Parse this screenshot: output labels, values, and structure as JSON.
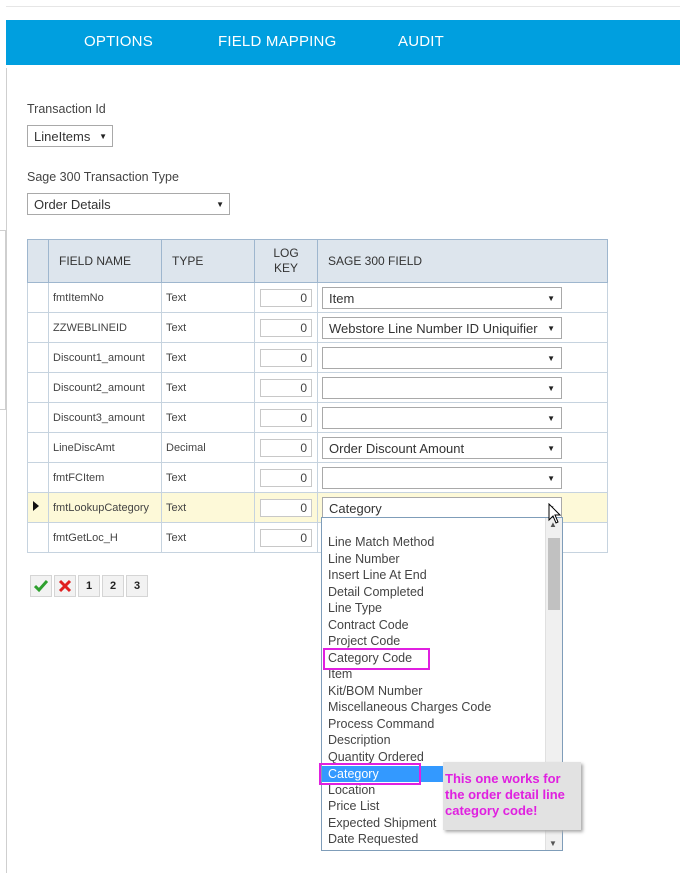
{
  "nav": {
    "tabs": [
      "OPTIONS",
      "FIELD MAPPING",
      "AUDIT"
    ]
  },
  "form": {
    "transaction_id_label": "Transaction Id",
    "transaction_id_value": "LineItems",
    "type_label": "Sage 300 Transaction Type",
    "type_value": "Order Details"
  },
  "grid": {
    "headers": [
      "FIELD NAME",
      "TYPE",
      "LOG KEY",
      "SAGE 300 FIELD"
    ],
    "rows": [
      {
        "field": "fmtItemNo",
        "type": "Text",
        "key": "0",
        "sage": "Item"
      },
      {
        "field": "ZZWEBLINEID",
        "type": "Text",
        "key": "0",
        "sage": "Webstore Line Number ID Uniquifier"
      },
      {
        "field": "Discount1_amount",
        "type": "Text",
        "key": "0",
        "sage": ""
      },
      {
        "field": "Discount2_amount",
        "type": "Text",
        "key": "0",
        "sage": ""
      },
      {
        "field": "Discount3_amount",
        "type": "Text",
        "key": "0",
        "sage": ""
      },
      {
        "field": "LineDiscAmt",
        "type": "Decimal",
        "key": "0",
        "sage": "Order Discount Amount"
      },
      {
        "field": "fmtFCItem",
        "type": "Text",
        "key": "0",
        "sage": ""
      },
      {
        "field": "fmtLookupCategory",
        "type": "Text",
        "key": "0",
        "sage": "Category"
      },
      {
        "field": "fmtGetLoc_H",
        "type": "Text",
        "key": "0",
        "sage": ""
      }
    ]
  },
  "pager": {
    "pages": [
      "1",
      "2",
      "3"
    ]
  },
  "dropdown": {
    "options": [
      "Line Match Method",
      "Line Number",
      "Insert Line At End",
      "Detail Completed",
      "Line Type",
      "Contract Code",
      "Project Code",
      "Category Code",
      "Item",
      "Kit/BOM Number",
      "Miscellaneous Charges Code",
      "Process Command",
      "Description",
      "Quantity Ordered",
      "Category",
      "Location",
      "Price List",
      "Expected Shipment",
      "Date Requested"
    ],
    "selected": "Category"
  },
  "callout": {
    "text": "This one works for the order detail line category code!"
  },
  "colors": {
    "nav": "#009fdf",
    "highlight_row": "#fdf9d8",
    "selected_option": "#3399ff",
    "annotation": "#e020e0"
  }
}
